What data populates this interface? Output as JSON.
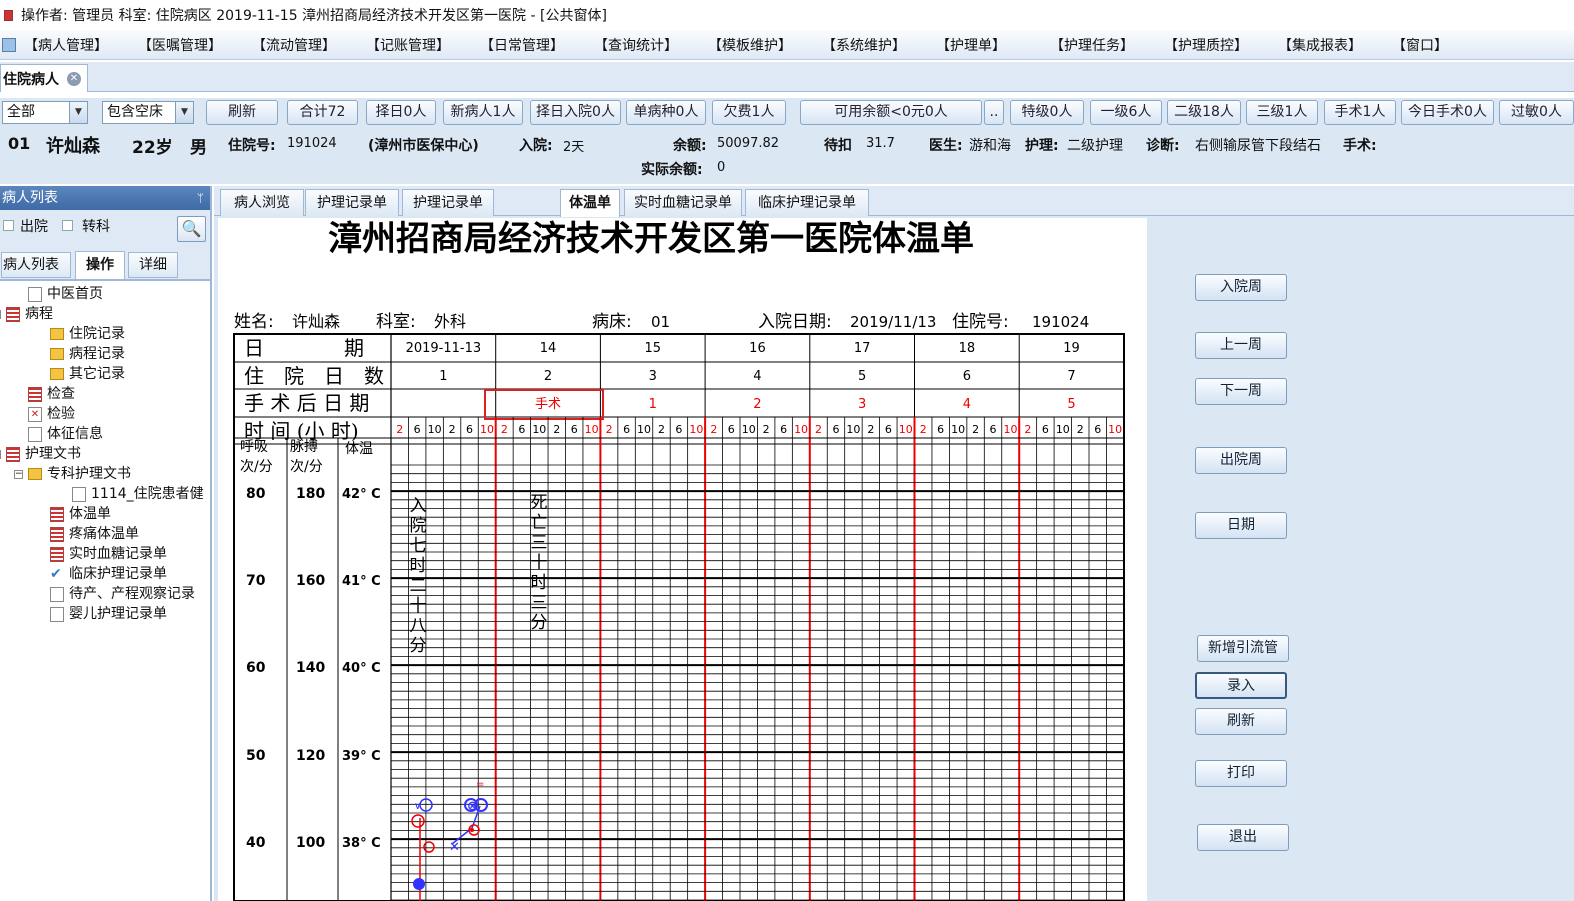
{
  "window": {
    "title": "操作者: 管理员  科室: 住院病区  2019-11-15  漳州招商局经济技术开发区第一医院 - [公共窗体]"
  },
  "menu": [
    "【病人管理】",
    "【医嘱管理】",
    "【流动管理】",
    "【记账管理】",
    "【日常管理】",
    "【查询统计】",
    "【模板维护】",
    "【系统维护】",
    "【护理单】",
    "【护理任务】",
    "【护理质控】",
    "【集成报表】",
    "【窗口】"
  ],
  "doc_tab": {
    "label": "住院病人",
    "close": "✕"
  },
  "toolbar": {
    "filter_all": "全部",
    "filter_bed": "包含空床",
    "buttons": [
      "刷新",
      "合计72",
      "择日0人",
      "新病人1人",
      "择日入院0人",
      "单病种0人",
      "欠费1人",
      "可用余额<0元0人",
      "..",
      "特级0人",
      "一级6人",
      "二级18人",
      "三级1人",
      "手术1人",
      "今日手术0人",
      "过敏0人"
    ]
  },
  "patient": {
    "bed": "01",
    "name": "许灿森",
    "age": "22岁",
    "sex": "男",
    "inpatient_label": "住院号:",
    "inpatient_no": "191024",
    "insurance": "(漳州市医保中心)",
    "admit_label": "入院:",
    "admit_days": "2天",
    "balance_label": "余额:",
    "balance": "50097.82",
    "pending_label": "待扣",
    "pending": "31.7",
    "doctor_label": "医生:",
    "doctor": "游和海",
    "nursing_label": "护理:",
    "nursing": "二级护理",
    "diagnosis_label": "诊断:",
    "diagnosis": "右侧输尿管下段结石",
    "surgery_label": "手术:",
    "actual_label": "实际余额:",
    "actual_balance": "0"
  },
  "left": {
    "title": "病人列表",
    "pin": "ᛘ",
    "cb_discharge": "出院",
    "cb_transfer": "转科",
    "tabs": [
      "病人列表",
      "操作",
      "详细"
    ],
    "tree": [
      {
        "label": "中医首页",
        "level": 1,
        "icon": "doc"
      },
      {
        "label": "病程",
        "level": 0,
        "icon": "grid",
        "exp": "−"
      },
      {
        "label": "住院记录",
        "level": 2,
        "icon": "folder"
      },
      {
        "label": "病程记录",
        "level": 2,
        "icon": "folder"
      },
      {
        "label": "其它记录",
        "level": 2,
        "icon": "folder"
      },
      {
        "label": "检查",
        "level": 1,
        "icon": "grid"
      },
      {
        "label": "检验",
        "level": 1,
        "icon": "xdoc"
      },
      {
        "label": "体征信息",
        "level": 1,
        "icon": "doc"
      },
      {
        "label": "护理文书",
        "level": 0,
        "icon": "grid",
        "exp": "−"
      },
      {
        "label": "专科护理文书",
        "level": 1,
        "icon": "folder",
        "exp": "−"
      },
      {
        "label": "1114_住院患者健",
        "level": 3,
        "icon": "doc"
      },
      {
        "label": "体温单",
        "level": 2,
        "icon": "grid"
      },
      {
        "label": "疼痛体温单",
        "level": 2,
        "icon": "grid"
      },
      {
        "label": "实时血糖记录单",
        "level": 2,
        "icon": "grid"
      },
      {
        "label": "临床护理记录单",
        "level": 2,
        "icon": "check"
      },
      {
        "label": "待产、产程观察记录",
        "level": 2,
        "icon": "doc"
      },
      {
        "label": "婴儿护理记录单",
        "level": 2,
        "icon": "doc"
      }
    ]
  },
  "tabs": [
    "病人浏览",
    "护理记录单",
    "护理记录单",
    "体温单",
    "体温单",
    "实时血糖记录单",
    "临床护理记录单"
  ],
  "active_tab": 4,
  "sheet": {
    "title": "漳州招商局经济技术开发区第一医院体温单",
    "name_label": "姓名:",
    "name": "许灿森",
    "dept_label": "科室:",
    "dept": "外科",
    "bed_label": "病床:",
    "bed": "01",
    "admit_date_label": "入院日期:",
    "admit_date": "2019/11/13",
    "inpatient_label": "住院号:",
    "inpatient_no": "191024",
    "row_date": "日　　　　期",
    "row_days": "住　院　日　数",
    "row_postop": "手 术 后 日 期",
    "row_time": "时 间  (小 时)",
    "dates": [
      "2019-11-13",
      "14",
      "15",
      "16",
      "17",
      "18",
      "19"
    ],
    "days": [
      "1",
      "2",
      "3",
      "4",
      "5",
      "6",
      "7"
    ],
    "postop": [
      "",
      "手术",
      "1",
      "2",
      "3",
      "4",
      "5"
    ],
    "hours": [
      "2",
      "6",
      "10",
      "2",
      "6",
      "10"
    ],
    "axis_headers": [
      "呼吸\n次/分",
      "脉搏\n次/分",
      "体温"
    ],
    "axis_rows": [
      {
        "resp": "80",
        "pulse": "180",
        "temp": "42° C"
      },
      {
        "resp": "70",
        "pulse": "160",
        "temp": "41° C"
      },
      {
        "resp": "60",
        "pulse": "140",
        "temp": "40° C"
      },
      {
        "resp": "50",
        "pulse": "120",
        "temp": "39° C"
      },
      {
        "resp": "40",
        "pulse": "100",
        "temp": "38° C"
      }
    ],
    "note_admit": "入院七时二十八分",
    "note_death": "死亡三十时三分"
  },
  "buttons": [
    "入院周",
    "上一周",
    "下一周",
    "出院周",
    "日期",
    "新增引流管",
    "录入",
    "刷新",
    "打印",
    "退出"
  ]
}
